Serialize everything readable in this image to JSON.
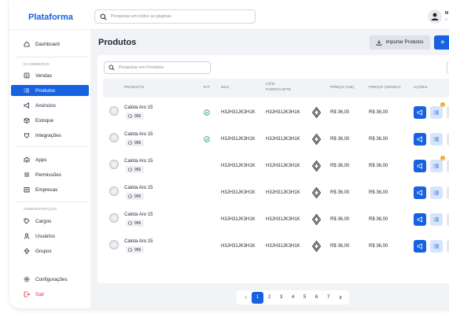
{
  "app": {
    "brand": "Plataforma"
  },
  "search": {
    "placeholder": "Pesquisar em todos as páginas"
  },
  "user": {
    "line1": "M",
    "line2": "A"
  },
  "sidebar": {
    "items": [
      {
        "label": "Dashboard",
        "icon": "home-icon"
      },
      {
        "label": "Vendas",
        "icon": "dollar-icon"
      },
      {
        "label": "Produtos",
        "icon": "list-icon",
        "active": true
      },
      {
        "label": "Anúncios",
        "icon": "megaphone-icon"
      },
      {
        "label": "Estoque",
        "icon": "box-icon"
      },
      {
        "label": "Integrações",
        "icon": "plug-icon"
      },
      {
        "label": "Apps",
        "icon": "apps-icon"
      },
      {
        "label": "Permissões",
        "icon": "sliders-icon"
      },
      {
        "label": "Empresas",
        "icon": "building-icon"
      },
      {
        "label": "Cargos",
        "icon": "tag-icon"
      },
      {
        "label": "Usuários",
        "icon": "user-icon"
      },
      {
        "label": "Grupos",
        "icon": "group-icon"
      },
      {
        "label": "Configurações",
        "icon": "gear-icon"
      },
      {
        "label": "Sair",
        "icon": "logout-icon"
      }
    ],
    "sections": {
      "ecommerce": "ECOMMERCE",
      "admin": "ADMINISTRAÇÃO"
    }
  },
  "page": {
    "title": "Produtos",
    "import_label": "Importar Produtos",
    "add_label": "+",
    "table_search_placeholder": "Pesquisar em Produtos"
  },
  "table": {
    "headers": {
      "produto": "PRODUTO",
      "kit": "KIT",
      "sku": "SKU",
      "cod_1": "CÓD.",
      "cod_2": "FABRICANTE",
      "preco_un": "PREÇO (UN)",
      "preco_venda": "PREÇO (VENDA)",
      "acoes": "AÇÕES"
    },
    "rows": [
      {
        "name": "Calota Aro 15",
        "qty": "956",
        "kit": true,
        "sku": "H3JH31JK3H1K",
        "cod": "H3JH31JK3H1K",
        "preco_un": "R$ 36,00",
        "preco_venda": "R$ 36,00",
        "badge": "1"
      },
      {
        "name": "Calota Aro 15",
        "qty": "956",
        "kit": true,
        "sku": "H3JH31JK3H1K",
        "cod": "H3JH31JK3H1K",
        "preco_un": "R$ 36,00",
        "preco_venda": "R$ 36,00"
      },
      {
        "name": "Calota Aro 15",
        "qty": "956",
        "kit": false,
        "sku": "H3JH31JK3H1K",
        "cod": "H3JH31JK3H1K",
        "preco_un": "R$ 36,00",
        "preco_venda": "R$ 36,00",
        "badge": "1"
      },
      {
        "name": "Calota Aro 15",
        "qty": "956",
        "kit": false,
        "sku": "H3JH31JK3H1K",
        "cod": "H3JH31JK3H1K",
        "preco_un": "R$ 36,00",
        "preco_venda": "R$ 36,00"
      },
      {
        "name": "Calota Aro 15",
        "qty": "956",
        "kit": false,
        "sku": "H3JH31JK3H1K",
        "cod": "H3JH31JK3H1K",
        "preco_un": "R$ 36,00",
        "preco_venda": "R$ 36,00"
      },
      {
        "name": "Calota Aro 15",
        "qty": "956",
        "kit": false,
        "sku": "H3JH31JK3H1K",
        "cod": "H3JH31JK3H1K",
        "preco_un": "R$ 36,00",
        "preco_venda": "R$ 36,00"
      }
    ]
  },
  "pagination": {
    "pages": [
      "1",
      "2",
      "3",
      "4",
      "5",
      "6",
      "7"
    ],
    "current": "1"
  },
  "colors": {
    "accent": "#1662e0",
    "danger": "#e0263a",
    "success": "#22a06b",
    "badge": "#f5a524"
  }
}
